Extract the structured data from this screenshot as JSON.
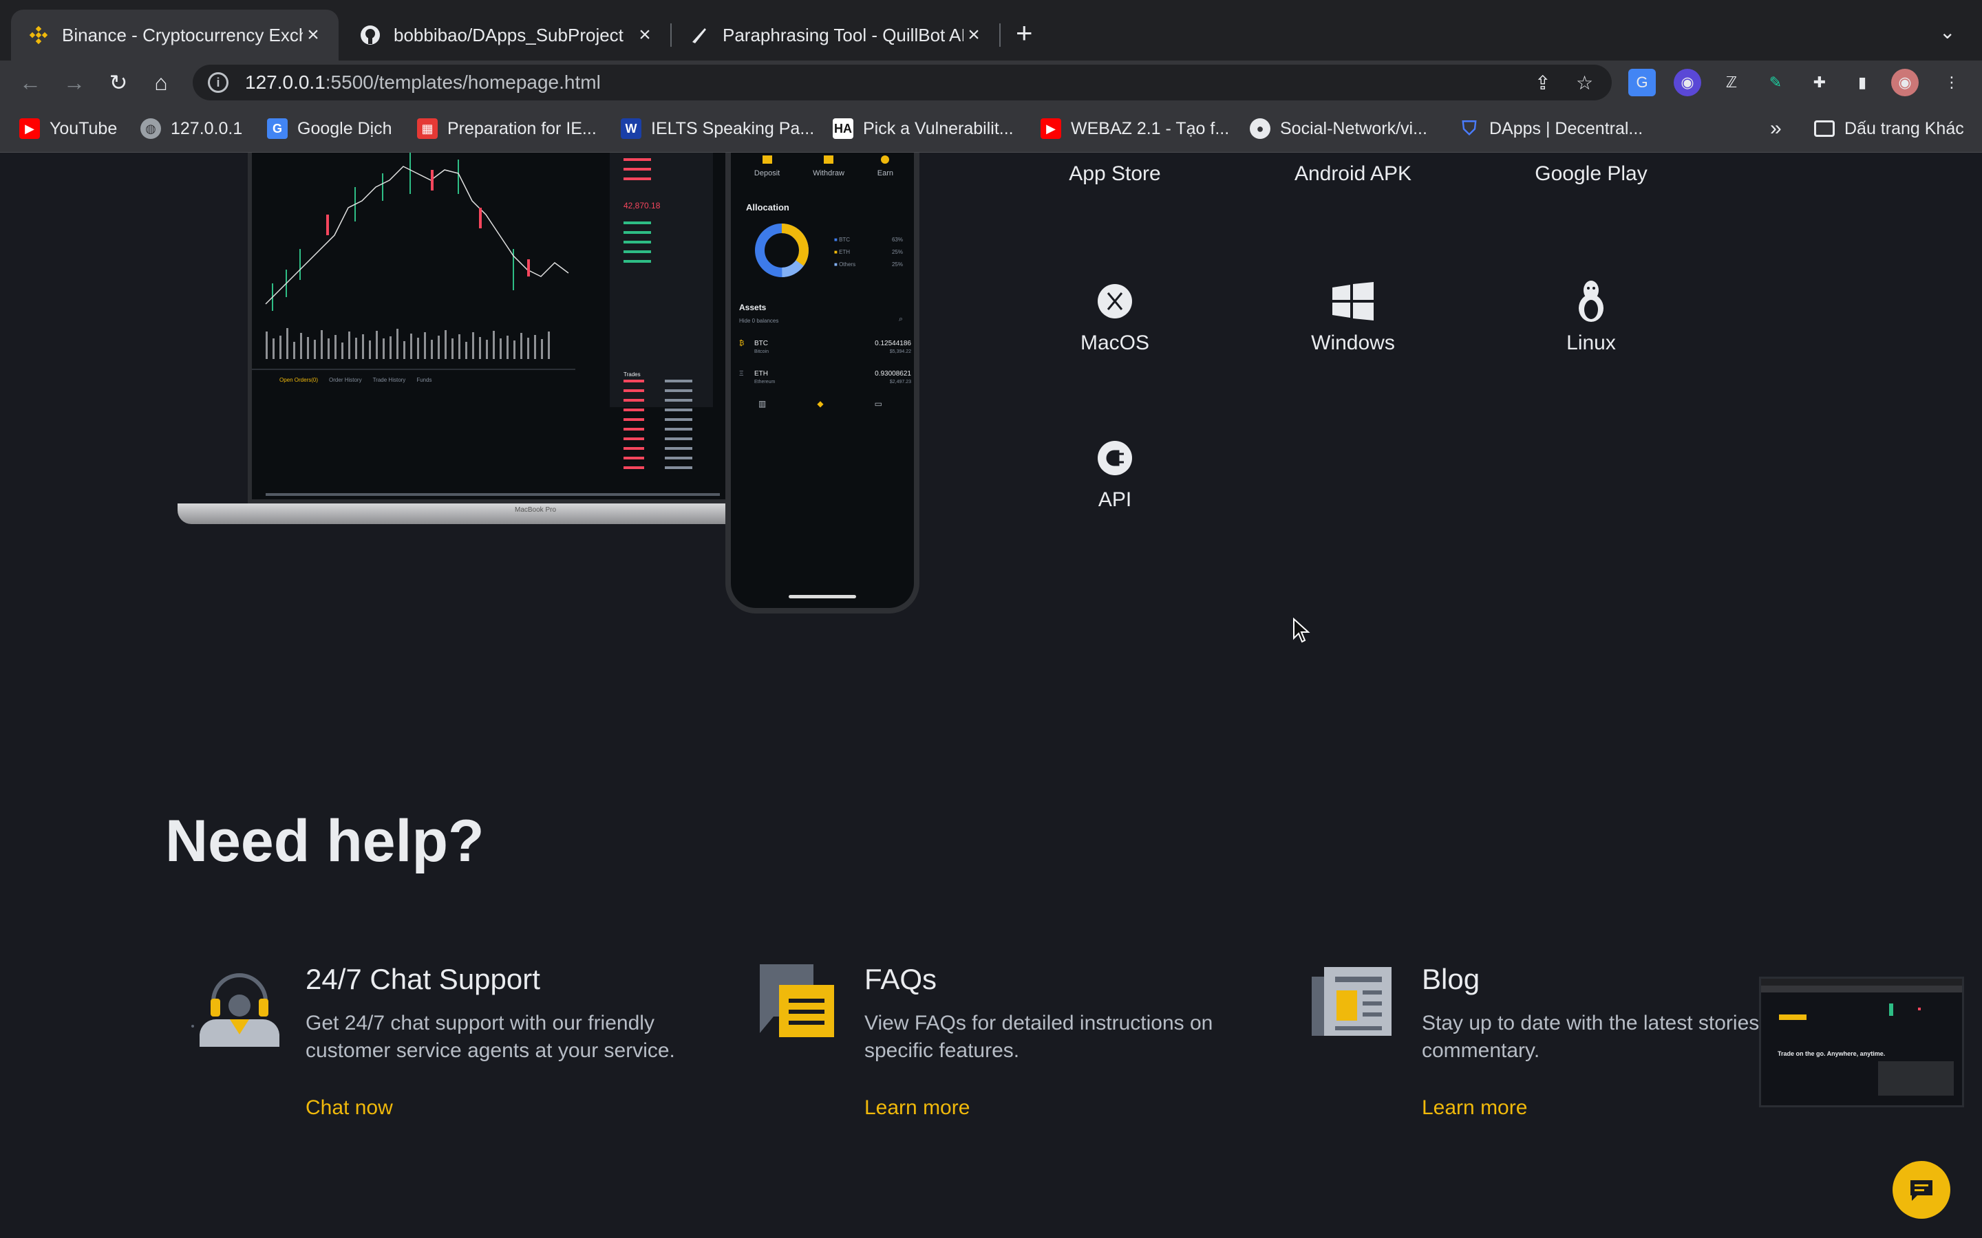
{
  "browser": {
    "tabs": [
      {
        "title": "Binance - Cryptocurrency Exch",
        "favicon": "binance-icon",
        "active": true
      },
      {
        "title": "bobbibao/DApps_SubProject",
        "favicon": "github-icon",
        "active": false
      },
      {
        "title": "Paraphrasing Tool - QuillBot AI",
        "favicon": "quillbot-icon",
        "active": false
      }
    ],
    "new_tab_label": "+",
    "url_host": "127.0.0.1",
    "url_rest": ":5500/templates/homepage.html",
    "bookmarks": [
      {
        "label": "YouTube",
        "icon": "youtube-icon",
        "color": "#ff0000"
      },
      {
        "label": "127.0.0.1",
        "icon": "globe-icon",
        "color": "#9aa0a6"
      },
      {
        "label": "Google Dịch",
        "icon": "google-translate-icon",
        "color": "#4285f4"
      },
      {
        "label": "Preparation for IE...",
        "icon": "bookmark-favicon-icon",
        "color": "#e53935"
      },
      {
        "label": "IELTS Speaking Pa...",
        "icon": "bookmark-favicon-icon",
        "color": "#1a3fa8"
      },
      {
        "label": "Pick a Vulnerabilit...",
        "icon": "bookmark-favicon-icon",
        "color": "#ffffff"
      },
      {
        "label": "WEBAZ 2.1 - Tạo f...",
        "icon": "youtube-icon",
        "color": "#ff0000"
      },
      {
        "label": "Social-Network/vi...",
        "icon": "github-icon",
        "color": "#ffffff"
      },
      {
        "label": "DApps | Decentral...",
        "icon": "shield-icon",
        "color": "#4a7cff"
      }
    ],
    "bookmarks_more": "»",
    "other_bookmarks": "Dấu trang Khác"
  },
  "downloads": [
    {
      "label": "App Store",
      "icon": "apple-icon"
    },
    {
      "label": "Android APK",
      "icon": "android-icon"
    },
    {
      "label": "Google Play",
      "icon": "google-play-icon"
    },
    {
      "label": "MacOS",
      "icon": "macos-icon"
    },
    {
      "label": "Windows",
      "icon": "windows-icon"
    },
    {
      "label": "Linux",
      "icon": "linux-icon"
    },
    {
      "label": "API",
      "icon": "api-icon"
    }
  ],
  "phone_app": {
    "actions": [
      "Deposit",
      "Withdraw",
      "Earn"
    ],
    "allocation_title": "Allocation",
    "allocation": [
      {
        "name": "BTC",
        "pct": "63%"
      },
      {
        "name": "ETH",
        "pct": "25%"
      },
      {
        "name": "Others",
        "pct": "25%"
      }
    ],
    "assets_title": "Assets",
    "hide_balances": "Hide 0 balances",
    "assets": [
      {
        "symbol": "BTC",
        "name": "Bitcoin",
        "amount": "0.12544186",
        "usd": "$5,394.22"
      },
      {
        "symbol": "ETH",
        "name": "Ethereum",
        "amount": "0.93008621",
        "usd": "$2,497.23"
      }
    ]
  },
  "laptop": {
    "tabs": [
      "Open Orders(0)",
      "Order History",
      "Trade History",
      "Funds"
    ],
    "price_badge": "42,870.18",
    "trades_title": "Trades",
    "brand": "MacBook Pro"
  },
  "help": {
    "title": "Need help?",
    "cards": [
      {
        "title": "24/7 Chat Support",
        "desc": "Get 24/7 chat support with our friendly customer service agents at your service.",
        "link": "Chat now",
        "icon": "headset-support-icon"
      },
      {
        "title": "FAQs",
        "desc": "View FAQs for detailed instructions on specific features.",
        "link": "Learn more",
        "icon": "faq-chat-icon"
      },
      {
        "title": "Blog",
        "desc": "Stay up to date with the latest stories and commentary.",
        "link": "Learn more",
        "icon": "newspaper-icon"
      }
    ]
  },
  "preview_caption": "Trade on the go. Anywhere, anytime.",
  "colors": {
    "accent": "#f0b90b",
    "background": "#181a20",
    "text": "#eaecef",
    "muted": "#b7bdc6"
  }
}
